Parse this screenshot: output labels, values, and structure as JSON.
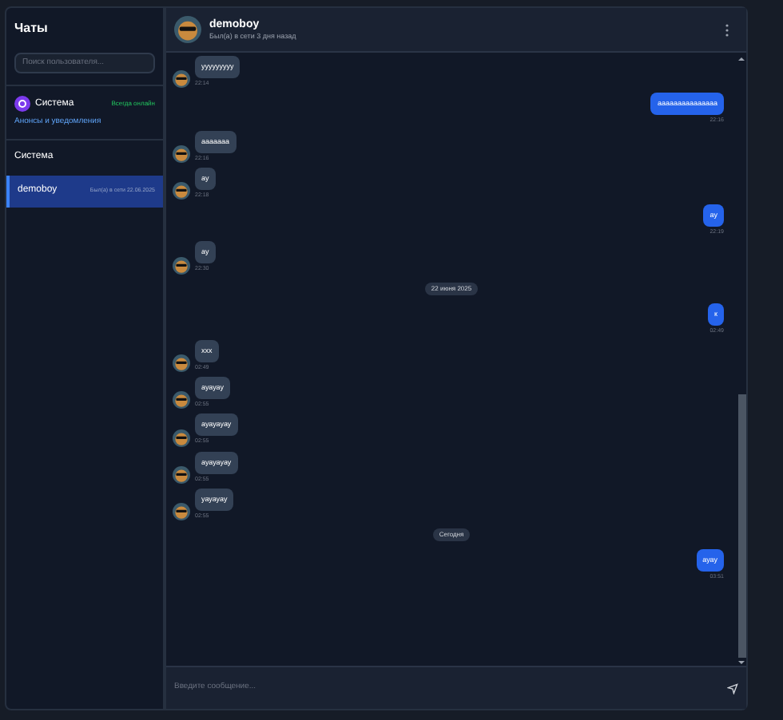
{
  "sidebar": {
    "title": "Чаты",
    "search": {
      "placeholder": "Поиск пользователя..."
    },
    "system": {
      "name": "Система",
      "status": "Всегда онлайн",
      "subtitle": "Анонсы и уведомления"
    },
    "section_title": "Система",
    "chats": [
      {
        "name": "demoboy",
        "status": "Был(а) в сети 22.06.2025",
        "selected": true
      }
    ]
  },
  "chat": {
    "name": "demoboy",
    "status": "Был(а) в сети 3 дня назад",
    "messages": [
      {
        "kind": "in",
        "text": "ууууууууу",
        "time": "22:14"
      },
      {
        "kind": "out",
        "text": "ааааааааааааааа",
        "time": "22:16"
      },
      {
        "kind": "in",
        "text": "ааааааа",
        "time": "22:16"
      },
      {
        "kind": "in",
        "text": "ау",
        "time": "22:18"
      },
      {
        "kind": "out",
        "text": "ау",
        "time": "22:19"
      },
      {
        "kind": "in",
        "text": "ау",
        "time": "22:30"
      },
      {
        "kind": "date",
        "text": "22 июня 2025"
      },
      {
        "kind": "out",
        "text": "к",
        "time": "02:49"
      },
      {
        "kind": "in",
        "text": "ххх",
        "time": "02:49"
      },
      {
        "kind": "in",
        "text": "ауауау",
        "time": "02:55"
      },
      {
        "kind": "in",
        "text": "ауауауау",
        "time": "02:55"
      },
      {
        "kind": "in",
        "text": "ауауауау",
        "time": "02:55"
      },
      {
        "kind": "in",
        "text": "уауауау",
        "time": "02:55"
      },
      {
        "kind": "date",
        "text": "Сегодня"
      },
      {
        "kind": "out",
        "text": "ауау",
        "time": "03:51"
      }
    ],
    "input": {
      "placeholder": "Введите сообщение..."
    }
  }
}
